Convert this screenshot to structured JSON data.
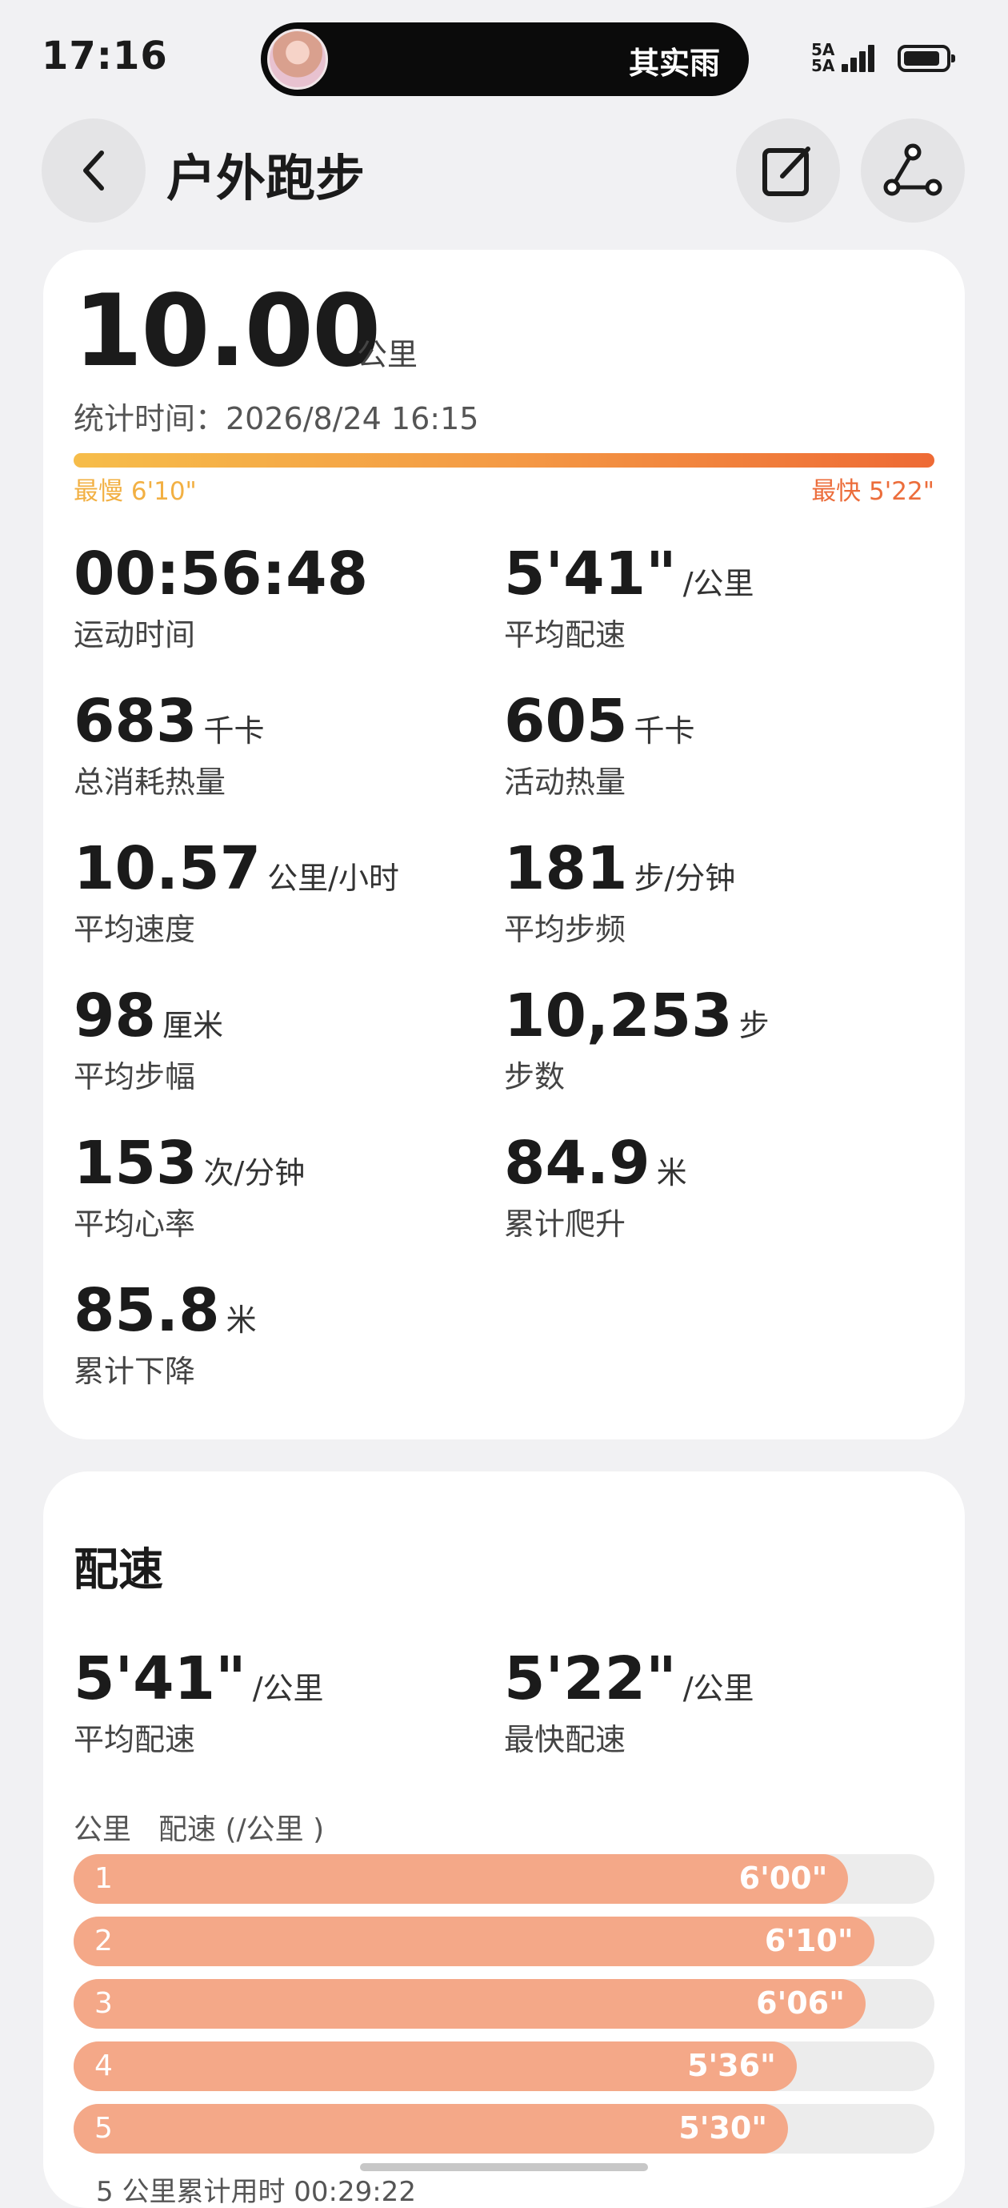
{
  "status_bar": {
    "time": "17:16",
    "island_text": "其实雨",
    "signal_label_1": "5A",
    "signal_label_2": "5A"
  },
  "header": {
    "title": "户外跑步",
    "back_icon": "chevron-left-icon",
    "edit_icon": "edit-note-icon",
    "route_icon": "route-share-icon"
  },
  "summary": {
    "distance": "10.00",
    "distance_unit": "公里",
    "stat_time": "统计时间：2026/8/24 16:15",
    "slowest_label": "最慢 6'10\"",
    "fastest_label": "最快 5'22\"",
    "metrics": [
      {
        "value": "00:56:48",
        "unit": "",
        "label": "运动时间"
      },
      {
        "value": "5'41\"",
        "unit": "/公里",
        "label": "平均配速"
      },
      {
        "value": "683",
        "unit": "千卡",
        "label": "总消耗热量"
      },
      {
        "value": "605",
        "unit": "千卡",
        "label": "活动热量"
      },
      {
        "value": "10.57",
        "unit": "公里/小时",
        "label": "平均速度"
      },
      {
        "value": "181",
        "unit": "步/分钟",
        "label": "平均步频"
      },
      {
        "value": "98",
        "unit": "厘米",
        "label": "平均步幅"
      },
      {
        "value": "10,253",
        "unit": "步",
        "label": "步数"
      },
      {
        "value": "153",
        "unit": "次/分钟",
        "label": "平均心率"
      },
      {
        "value": "84.9",
        "unit": "米",
        "label": "累计爬升"
      },
      {
        "value": "85.8",
        "unit": "米",
        "label": "累计下降"
      }
    ]
  },
  "pace": {
    "title": "配速",
    "avg": {
      "value": "5'41\"",
      "unit": "/公里",
      "label": "平均配速"
    },
    "fastest": {
      "value": "5'22\"",
      "unit": "/公里",
      "label": "最快配速"
    },
    "col_km": "公里",
    "col_pace": "配速 (/公里 )",
    "splits": [
      {
        "km": "1",
        "pace": "6'00\"",
        "fill": 0.9
      },
      {
        "km": "2",
        "pace": "6'10\"",
        "fill": 0.93
      },
      {
        "km": "3",
        "pace": "6'06\"",
        "fill": 0.92
      },
      {
        "km": "4",
        "pace": "5'36\"",
        "fill": 0.84
      },
      {
        "km": "5",
        "pace": "5'30\"",
        "fill": 0.83
      }
    ],
    "cumulative_note": "5 公里累计用时 00:29:22"
  },
  "colors": {
    "accent_slow": "#f2b043",
    "accent_fast": "#ec6d3b",
    "split_fill": "#f4a888"
  }
}
